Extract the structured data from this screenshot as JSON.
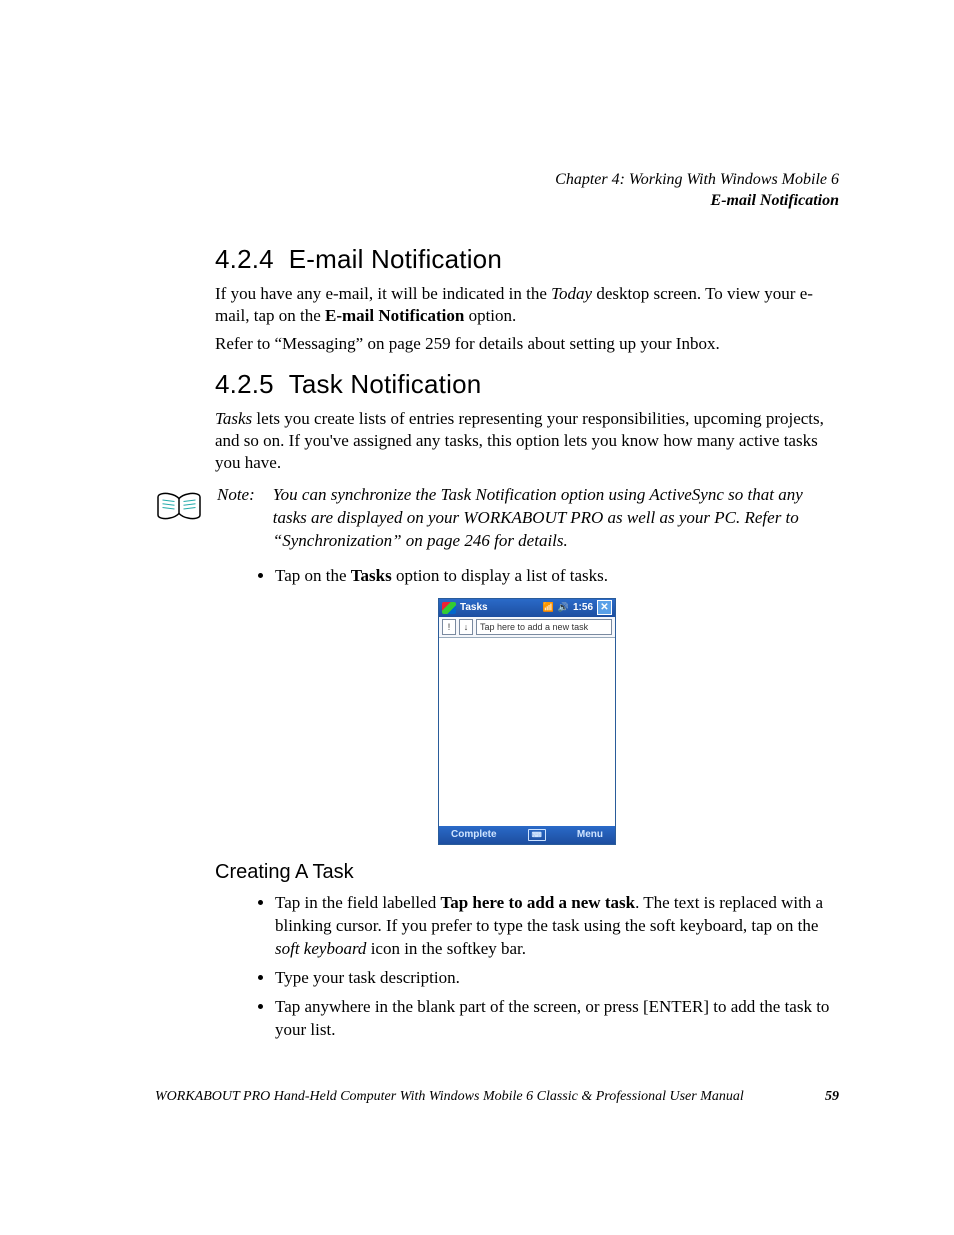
{
  "header": {
    "chapter_line": "Chapter  4:  Working With Windows Mobile 6",
    "topic_line": "E-mail Notification"
  },
  "sections": {
    "s1": {
      "num": "4.2.4",
      "title": "E-mail Notification",
      "p1_a": "If you have any e-mail, it will be indicated in the ",
      "p1_em": "Today",
      "p1_b": " desktop screen. To view your e-mail, tap on the ",
      "p1_bold": "E-mail Notification",
      "p1_c": " option.",
      "p2": "Refer to “Messaging” on page 259 for details about setting up your Inbox."
    },
    "s2": {
      "num": "4.2.5",
      "title": "Task Notification",
      "p1_em": "Tasks",
      "p1_rest": " lets you create lists of entries representing your responsibilities, upcoming projects, and so on. If you've assigned any tasks, this option lets you know how many active tasks you have.",
      "note_label": "Note:",
      "note_body": "You can synchronize the Task Notification option using ActiveSync so that any tasks are displayed on your WORKABOUT PRO as well as your PC. Refer to “Synchronization” on page 246 for details.",
      "bullet1_a": "Tap on the ",
      "bullet1_bold": "Tasks",
      "bullet1_b": " option to display a list of tasks."
    },
    "s3": {
      "title": "Creating A Task",
      "b1_a": "Tap in the field labelled ",
      "b1_bold": "Tap here to add a new task",
      "b1_b": ". The text is replaced with a blinking cursor. If you prefer to type the task using the soft keyboard, tap on the ",
      "b1_em": "soft keyboard",
      "b1_c": " icon in the softkey bar.",
      "b2": "Type your task description.",
      "b3": "Tap anywhere in the blank part of the screen, or press [ENTER] to add the task to your list."
    }
  },
  "device": {
    "title": "Tasks",
    "time": "1:56",
    "add_placeholder": "Tap here to add a new task",
    "soft_left": "Complete",
    "soft_right": "Menu"
  },
  "footer": {
    "text": "WORKABOUT PRO Hand-Held Computer With Windows Mobile 6 Classic & Professional User Manual",
    "page": "59"
  }
}
